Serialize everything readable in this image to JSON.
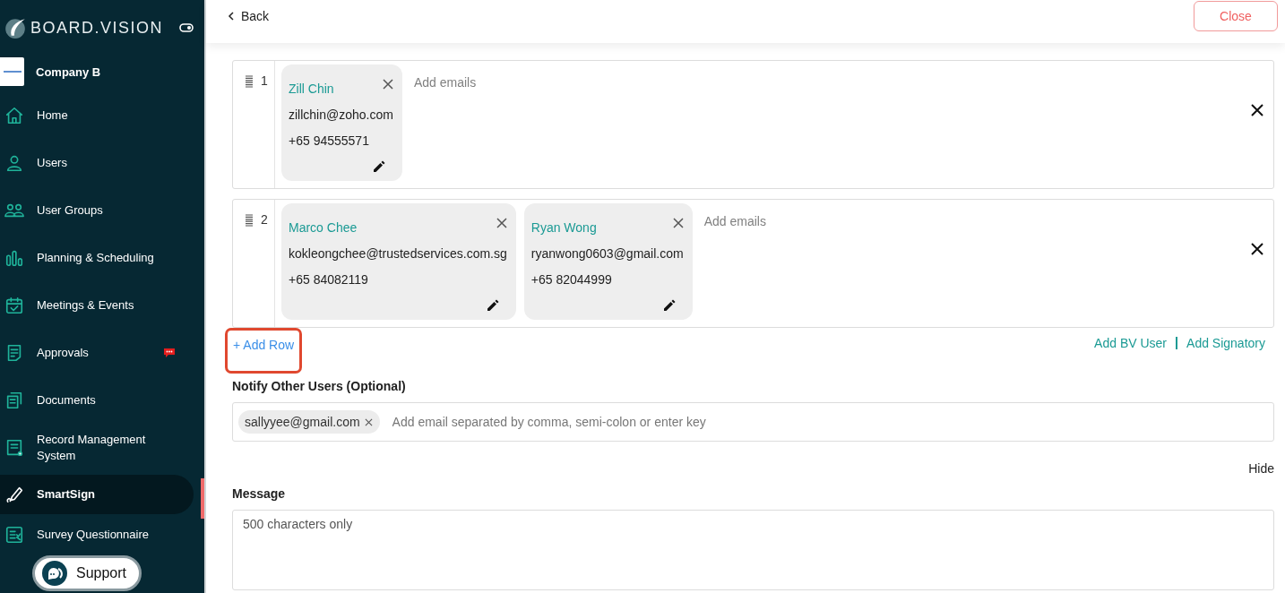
{
  "sidebar": {
    "brand": "BOARD.VISION",
    "company": "Company B",
    "items": [
      {
        "label": "Home",
        "selected": false,
        "notification": false
      },
      {
        "label": "Users",
        "selected": false,
        "notification": false
      },
      {
        "label": "User Groups",
        "selected": false,
        "notification": false
      },
      {
        "label": "Planning & Scheduling",
        "selected": false,
        "notification": false
      },
      {
        "label": "Meetings & Events",
        "selected": false,
        "notification": false
      },
      {
        "label": "Approvals",
        "selected": false,
        "notification": true
      },
      {
        "label": "Documents",
        "selected": false,
        "notification": false
      },
      {
        "label": "Record Management System",
        "selected": false,
        "notification": false
      },
      {
        "label": "SmartSign",
        "selected": true,
        "notification": false
      },
      {
        "label": "Survey Questionnaire",
        "selected": false,
        "notification": false
      }
    ],
    "support": "Support"
  },
  "header": {
    "back": "Back",
    "close": "Close"
  },
  "signer_rows": [
    {
      "number": "1",
      "placeholder": "Add emails",
      "cards": [
        {
          "name": "Zill Chin",
          "email": "zillchin@zoho.com",
          "phone": "+65 94555571"
        }
      ]
    },
    {
      "number": "2",
      "placeholder": "Add emails",
      "cards": [
        {
          "name": "Marco Chee",
          "email": "kokleongchee@trustedservices.com.sg",
          "phone": "+65 84082119"
        },
        {
          "name": "Ryan Wong",
          "email": "ryanwong0603@gmail.com",
          "phone": "+65 82044999"
        }
      ]
    }
  ],
  "add_row": "+ Add Row",
  "add_row_highlighted": true,
  "links": [
    "Add BV User",
    "Add Signatory"
  ],
  "notify": {
    "label": "Notify Other Users (Optional)",
    "chips": [
      "sallyyee@gmail.com"
    ],
    "placeholder": "Add email separated by comma, semi-colon or enter key"
  },
  "hide": "Hide",
  "message": {
    "label": "Message",
    "placeholder": "500 characters only"
  }
}
